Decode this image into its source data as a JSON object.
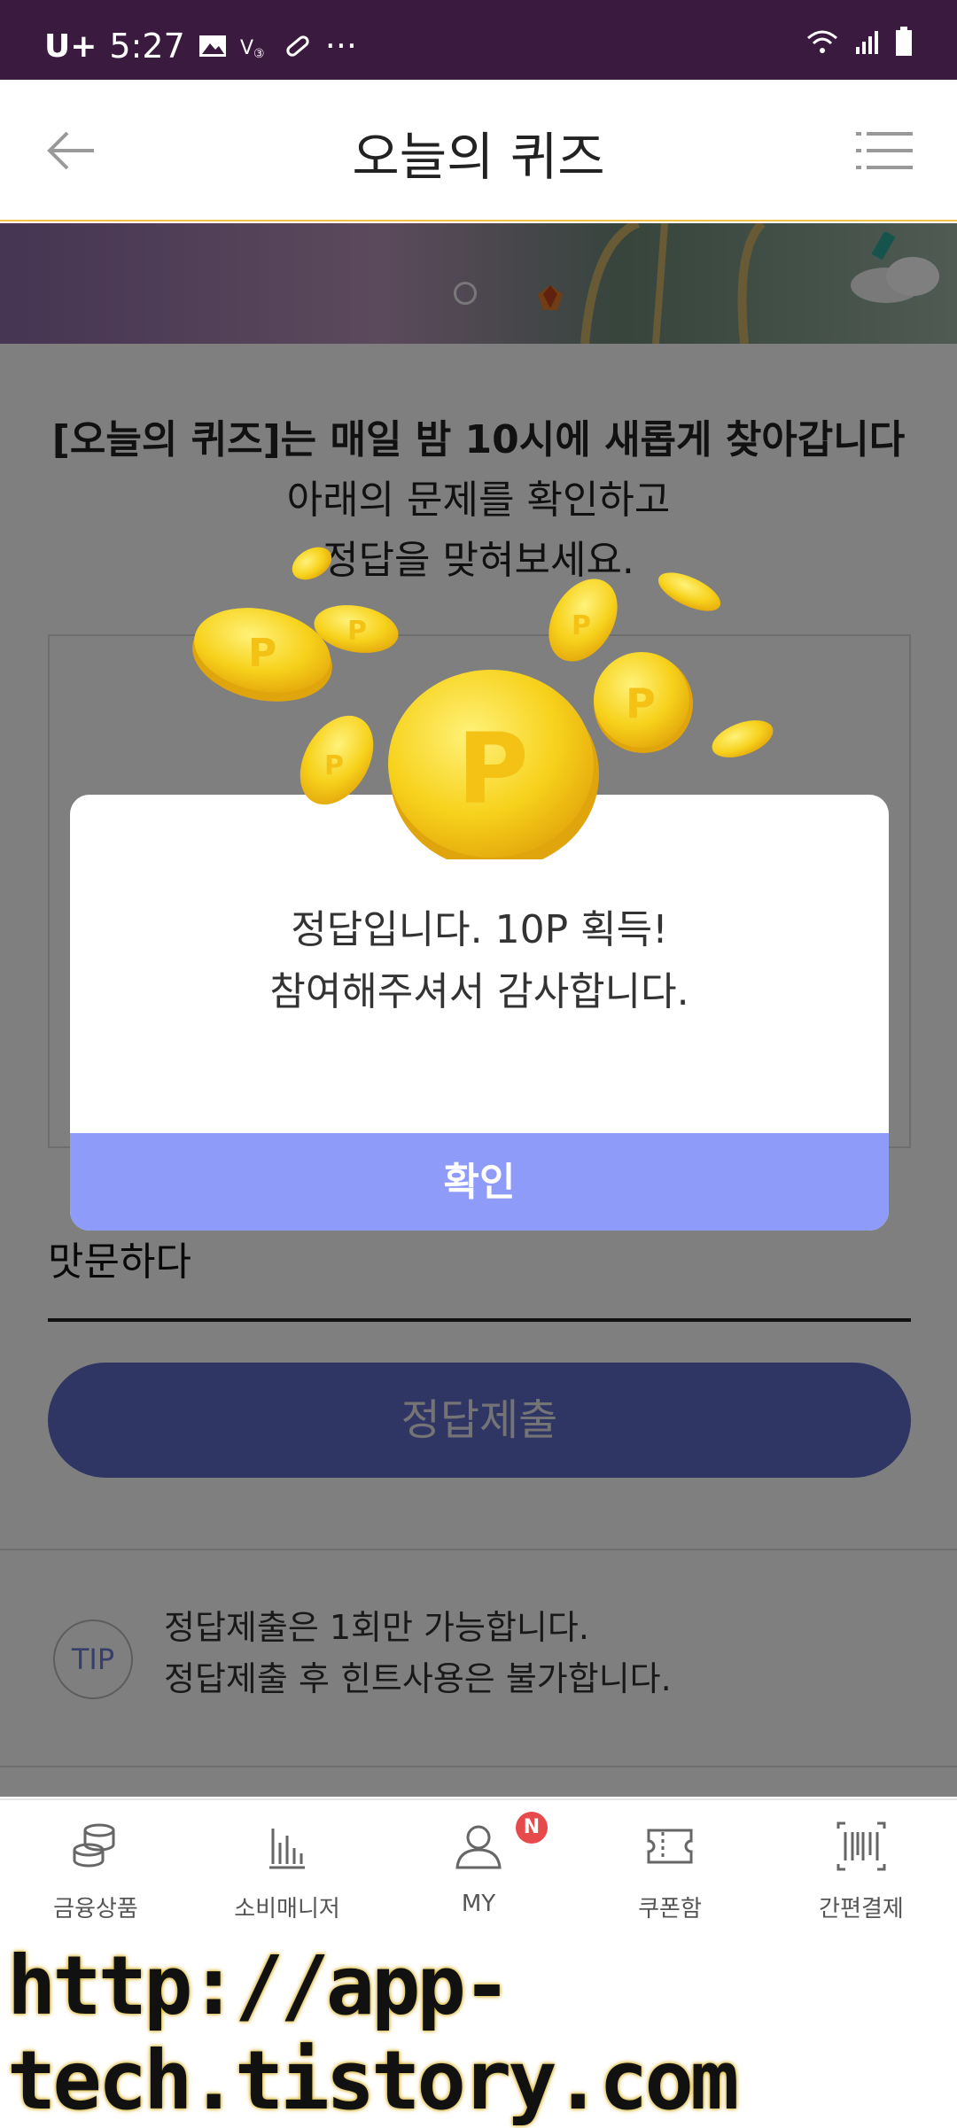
{
  "status_bar": {
    "carrier": "U+",
    "time": "5:27",
    "more": "···"
  },
  "header": {
    "title": "오늘의 퀴즈"
  },
  "intro": {
    "line1": "[오늘의 퀴즈]는 매일 밤 10시에 새롭게 찾아갑니다",
    "line2": "아래의 문제를 확인하고",
    "line3": "정답을 맞혀보세요."
  },
  "answer": {
    "value": "맛문하다"
  },
  "submit_button": {
    "label": "정답제출"
  },
  "tip": {
    "badge": "TIP",
    "line1": "정답제출은 1회만 가능합니다.",
    "line2": "정답제출 후 힌트사용은 불가합니다."
  },
  "modal": {
    "message_line1": "정답입니다. 10P 획득!",
    "message_line2": "참여해주셔서 감사합니다.",
    "confirm_label": "확인"
  },
  "bottom_nav": {
    "items": [
      {
        "label": "금융상품",
        "icon": "coins-stack-icon"
      },
      {
        "label": "소비매니저",
        "icon": "bar-chart-icon"
      },
      {
        "label": "MY",
        "icon": "person-icon",
        "badge": "N"
      },
      {
        "label": "쿠폰함",
        "icon": "ticket-icon"
      },
      {
        "label": "간편결제",
        "icon": "barcode-icon"
      }
    ]
  },
  "watermark": {
    "text": "http://app-tech.tistory.com"
  },
  "colors": {
    "status_bar": "#3b1a3f",
    "modal_button": "#8e9bf9",
    "submit_button": "#5f6cc8",
    "badge": "#e74a4a"
  }
}
